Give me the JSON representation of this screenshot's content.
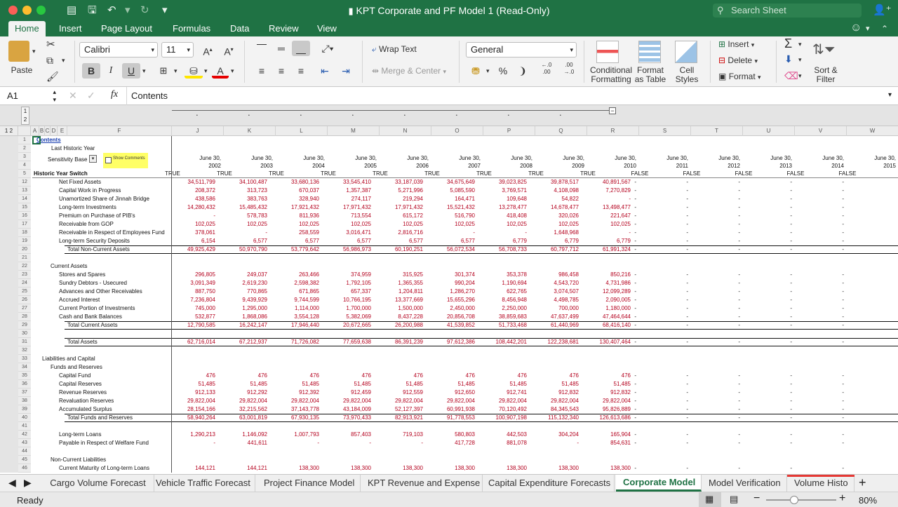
{
  "window": {
    "title": "KPT Corporate and PF Model 1  (Read-Only)",
    "search_placeholder": "Search Sheet"
  },
  "ribbon_tabs": [
    "Home",
    "Insert",
    "Page Layout",
    "Formulas",
    "Data",
    "Review",
    "View"
  ],
  "ribbon": {
    "paste": "Paste",
    "font_name": "Calibri",
    "font_size": "11",
    "bold": "B",
    "italic": "I",
    "underline": "U",
    "wrap_text": "Wrap Text",
    "merge_center": "Merge & Center",
    "number_format": "General",
    "percent": "%",
    "comma": "❩",
    "inc_decimal": "←.0\n.00",
    "dec_decimal": ".00\n→.0",
    "conditional": [
      "Conditional",
      "Formatting"
    ],
    "format_table": [
      "Format",
      "as Table"
    ],
    "cell_styles": [
      "Cell",
      "Styles"
    ],
    "insert": "Insert",
    "delete": "Delete",
    "format": "Format",
    "sort_filter": [
      "Sort &",
      "Filter"
    ]
  },
  "formula_bar": {
    "name_box": "A1",
    "fx": "fx",
    "content": "Contents"
  },
  "outline": {
    "levels": [
      "1",
      "2"
    ]
  },
  "columns": [
    "A",
    "B",
    "C",
    "D",
    "E",
    "F",
    "J",
    "K",
    "L",
    "M",
    "N",
    "O",
    "P",
    "Q",
    "R",
    "S",
    "T",
    "U",
    "V",
    "W"
  ],
  "top_rows": {
    "r1": "Contents",
    "r2": "Last Historic Year",
    "r3_label": "Sensitivity Base",
    "show_comments": "Show Comments",
    "r5": "Historic Year Switch"
  },
  "years": [
    "2002",
    "2003",
    "2004",
    "2005",
    "2006",
    "2007",
    "2008",
    "2009",
    "2010",
    "2011",
    "2012",
    "2013",
    "2014",
    "2015"
  ],
  "date_prefix": "June 30,",
  "switches": [
    "TRUE",
    "TRUE",
    "TRUE",
    "TRUE",
    "TRUE",
    "TRUE",
    "TRUE",
    "TRUE",
    "TRUE",
    "FALSE",
    "FALSE",
    "FALSE",
    "FALSE",
    "FALSE"
  ],
  "rows": [
    {
      "n": "12",
      "label": "Net Fixed Assets",
      "ind": 2,
      "v": [
        "34,511,799",
        "34,100,487",
        "33,680,136",
        "33,545,410",
        "33,187,039",
        "34,675,649",
        "39,023,825",
        "39,878,517",
        "40,891,567"
      ]
    },
    {
      "n": "13",
      "label": "Capital Work in Progress",
      "ind": 2,
      "v": [
        "208,372",
        "313,723",
        "670,037",
        "1,357,387",
        "5,271,996",
        "5,085,590",
        "3,769,571",
        "4,108,098",
        "7,270,829"
      ]
    },
    {
      "n": "14",
      "label": "Unamortized Share of Jinnah Bridge",
      "ind": 2,
      "v": [
        "438,586",
        "383,763",
        "328,940",
        "274,117",
        "219,294",
        "164,471",
        "109,648",
        "54,822",
        "-"
      ]
    },
    {
      "n": "15",
      "label": "Long-term Investments",
      "ind": 2,
      "v": [
        "14,280,432",
        "15,485,432",
        "17,921,432",
        "17,971,432",
        "17,971,432",
        "15,521,432",
        "13,278,477",
        "14,678,477",
        "13,498,477"
      ]
    },
    {
      "n": "16",
      "label": "Premium on Purchase of PIB's",
      "ind": 2,
      "v": [
        "-",
        "578,783",
        "811,936",
        "713,554",
        "615,172",
        "516,790",
        "418,408",
        "320,026",
        "221,647"
      ]
    },
    {
      "n": "17",
      "label": "Receivable from GOP",
      "ind": 2,
      "v": [
        "102,025",
        "102,025",
        "102,025",
        "102,025",
        "102,025",
        "102,025",
        "102,025",
        "102,025",
        "102,025"
      ]
    },
    {
      "n": "18",
      "label": "Receivable in Respect of Employees Fund",
      "ind": 2,
      "v": [
        "378,061",
        "-",
        "258,559",
        "3,016,471",
        "2,816,716",
        "-",
        "-",
        "1,648,968",
        "-"
      ]
    },
    {
      "n": "19",
      "label": "Long-term Security Deposits",
      "ind": 2,
      "v": [
        "6,154",
        "6,577",
        "6,577",
        "6,577",
        "6,577",
        "6,577",
        "6,779",
        "6,779",
        "6,779"
      ]
    },
    {
      "n": "20",
      "label": "Total Non-Current Assets",
      "ind": 3,
      "total": true,
      "v": [
        "49,925,429",
        "50,970,790",
        "53,779,642",
        "56,986,973",
        "60,190,251",
        "56,072,534",
        "56,708,733",
        "60,797,712",
        "61,991,324"
      ]
    },
    {
      "n": "21",
      "label": "",
      "ind": 0,
      "v": []
    },
    {
      "n": "22",
      "label": "Current Assets",
      "ind": 1,
      "v": []
    },
    {
      "n": "23",
      "label": "Stores and Spares",
      "ind": 2,
      "v": [
        "296,805",
        "249,037",
        "263,466",
        "374,959",
        "315,925",
        "301,374",
        "353,378",
        "986,458",
        "850,216"
      ]
    },
    {
      "n": "24",
      "label": "Sundry Debtors - Usecured",
      "ind": 2,
      "v": [
        "3,091,349",
        "2,619,230",
        "2,598,382",
        "1,792,105",
        "1,365,355",
        "990,204",
        "1,190,694",
        "4,543,720",
        "4,731,986"
      ]
    },
    {
      "n": "25",
      "label": "Advances and Other Receivables",
      "ind": 2,
      "v": [
        "887,750",
        "770,865",
        "671,865",
        "657,337",
        "1,204,811",
        "1,286,270",
        "622,765",
        "3,074,507",
        "12,099,289"
      ]
    },
    {
      "n": "26",
      "label": "Accrued Interest",
      "ind": 2,
      "v": [
        "7,236,804",
        "9,439,929",
        "9,744,599",
        "10,766,195",
        "13,377,669",
        "15,655,296",
        "8,456,948",
        "4,498,785",
        "2,090,005"
      ]
    },
    {
      "n": "27",
      "label": "Current Portion of Investments",
      "ind": 2,
      "v": [
        "745,000",
        "1,295,000",
        "1,114,000",
        "1,700,000",
        "1,500,000",
        "2,450,000",
        "2,250,000",
        "700,000",
        "1,180,000"
      ]
    },
    {
      "n": "28",
      "label": "Cash and Bank Balances",
      "ind": 2,
      "v": [
        "532,877",
        "1,868,086",
        "3,554,128",
        "5,382,069",
        "8,437,228",
        "20,856,708",
        "38,859,683",
        "47,637,499",
        "47,464,644"
      ]
    },
    {
      "n": "29",
      "label": "Total Current Assets",
      "ind": 3,
      "total": true,
      "v": [
        "12,790,585",
        "16,242,147",
        "17,946,440",
        "20,672,665",
        "26,200,988",
        "41,539,852",
        "51,733,468",
        "61,440,969",
        "68,416,140"
      ]
    },
    {
      "n": "30",
      "label": "",
      "ind": 0,
      "v": []
    },
    {
      "n": "31",
      "label": "Total Assets",
      "ind": 3,
      "total": true,
      "v": [
        "62,716,014",
        "67,212,937",
        "71,726,082",
        "77,659,638",
        "86,391,239",
        "97,612,386",
        "108,442,201",
        "122,238,681",
        "130,407,464"
      ]
    },
    {
      "n": "32",
      "label": "",
      "ind": 0,
      "v": []
    },
    {
      "n": "33",
      "label": "Liabilities and Capital",
      "ind": 0,
      "v": []
    },
    {
      "n": "34",
      "label": "Funds and Reserves",
      "ind": 1,
      "v": []
    },
    {
      "n": "35",
      "label": "Capital Fund",
      "ind": 2,
      "v": [
        "476",
        "476",
        "476",
        "476",
        "476",
        "476",
        "476",
        "476",
        "476"
      ]
    },
    {
      "n": "36",
      "label": "Capital Reserves",
      "ind": 2,
      "v": [
        "51,485",
        "51,485",
        "51,485",
        "51,485",
        "51,485",
        "51,485",
        "51,485",
        "51,485",
        "51,485"
      ]
    },
    {
      "n": "37",
      "label": "Revenue Reserves",
      "ind": 2,
      "v": [
        "912,133",
        "912,292",
        "912,392",
        "912,459",
        "912,559",
        "912,650",
        "912,741",
        "912,832",
        "912,832"
      ]
    },
    {
      "n": "38",
      "label": "Revaluation Reserves",
      "ind": 2,
      "v": [
        "29,822,004",
        "29,822,004",
        "29,822,004",
        "29,822,004",
        "29,822,004",
        "29,822,004",
        "29,822,004",
        "29,822,004",
        "29,822,004"
      ]
    },
    {
      "n": "39",
      "label": "Accumulated Surplus",
      "ind": 2,
      "v": [
        "28,154,166",
        "32,215,562",
        "37,143,778",
        "43,184,009",
        "52,127,397",
        "60,991,938",
        "70,120,492",
        "84,345,543",
        "95,826,889"
      ]
    },
    {
      "n": "40",
      "label": "Total Funds and Reserves",
      "ind": 3,
      "total": true,
      "v": [
        "58,940,264",
        "63,001,819",
        "67,930,135",
        "73,970,433",
        "82,913,921",
        "91,778,553",
        "100,907,198",
        "115,132,340",
        "126,613,686"
      ]
    },
    {
      "n": "41",
      "label": "",
      "ind": 0,
      "v": []
    },
    {
      "n": "42",
      "label": "Long-term Loans",
      "ind": 2,
      "v": [
        "1,290,213",
        "1,146,092",
        "1,007,793",
        "857,403",
        "719,103",
        "580,803",
        "442,503",
        "304,204",
        "165,904"
      ]
    },
    {
      "n": "43",
      "label": "Payable in Respect of Welfare Fund",
      "ind": 2,
      "v": [
        "-",
        "441,611",
        "-",
        "-",
        "-",
        "417,728",
        "881,078",
        "-",
        "854,631"
      ]
    },
    {
      "n": "44",
      "label": "",
      "ind": 0,
      "v": []
    },
    {
      "n": "45",
      "label": "Non-Current Liabilities",
      "ind": 1,
      "v": []
    },
    {
      "n": "46",
      "label": "Current Maturity of Long-term Loans",
      "ind": 2,
      "v": [
        "144,121",
        "144,121",
        "138,300",
        "138,300",
        "138,300",
        "138,300",
        "138,300",
        "138,300",
        "138,300"
      ]
    }
  ],
  "sheet_tabs": [
    "Cargo Volume Forecast",
    "Vehicle Traffic Forecast",
    "Project Finance Model",
    "KPT Revenue and Expense",
    "Capital Expenditure Forecasts",
    "Corporate Model",
    "Model Verification",
    "Volume Histo"
  ],
  "active_sheet": "Corporate Model",
  "status": {
    "ready": "Ready",
    "zoom": "80%"
  },
  "colors": {
    "excel_green": "#1f7244",
    "value_red": "#b4001d",
    "highlight_yellow": "#ffff66"
  }
}
